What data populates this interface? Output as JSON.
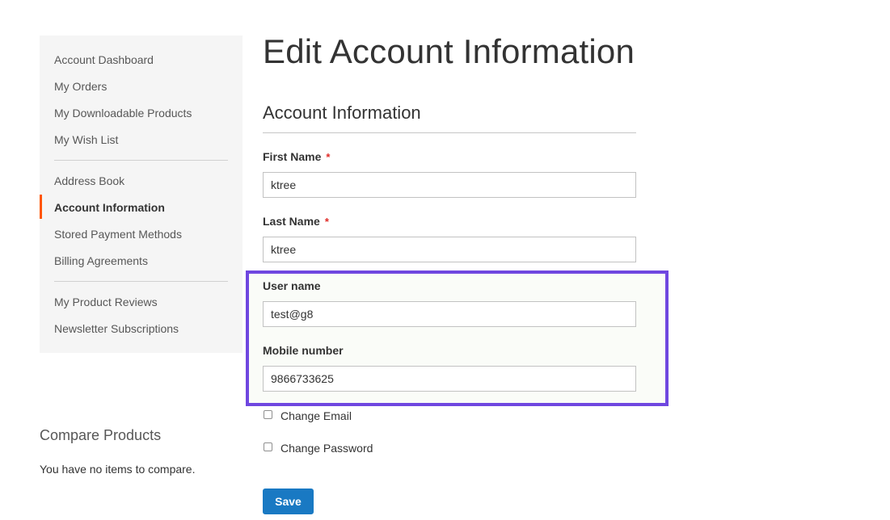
{
  "sidebar": {
    "items": [
      {
        "label": "Account Dashboard"
      },
      {
        "label": "My Orders"
      },
      {
        "label": "My Downloadable Products"
      },
      {
        "label": "My Wish List"
      },
      {
        "label": "Address Book"
      },
      {
        "label": "Account Information"
      },
      {
        "label": "Stored Payment Methods"
      },
      {
        "label": "Billing Agreements"
      },
      {
        "label": "My Product Reviews"
      },
      {
        "label": "Newsletter Subscriptions"
      }
    ],
    "current": "Account Information"
  },
  "compare": {
    "title": "Compare Products",
    "empty_text": "You have no items to compare."
  },
  "page": {
    "title": "Edit Account Information"
  },
  "form": {
    "legend": "Account Information",
    "required_marker": "*",
    "first_name": {
      "label": "First Name",
      "value": "ktree"
    },
    "last_name": {
      "label": "Last Name",
      "value": "ktree"
    },
    "user_name": {
      "label": "User name",
      "value": "test@g8"
    },
    "mobile_number": {
      "label": "Mobile number",
      "value": "9866733625"
    },
    "change_email": {
      "label": "Change Email",
      "checked": false
    },
    "change_password": {
      "label": "Change Password",
      "checked": false
    },
    "save_label": "Save"
  },
  "colors": {
    "accent_current_nav": "#ff5501",
    "primary_button": "#1979c3",
    "highlight_border": "#6f47e0",
    "required": "#e02b27"
  }
}
